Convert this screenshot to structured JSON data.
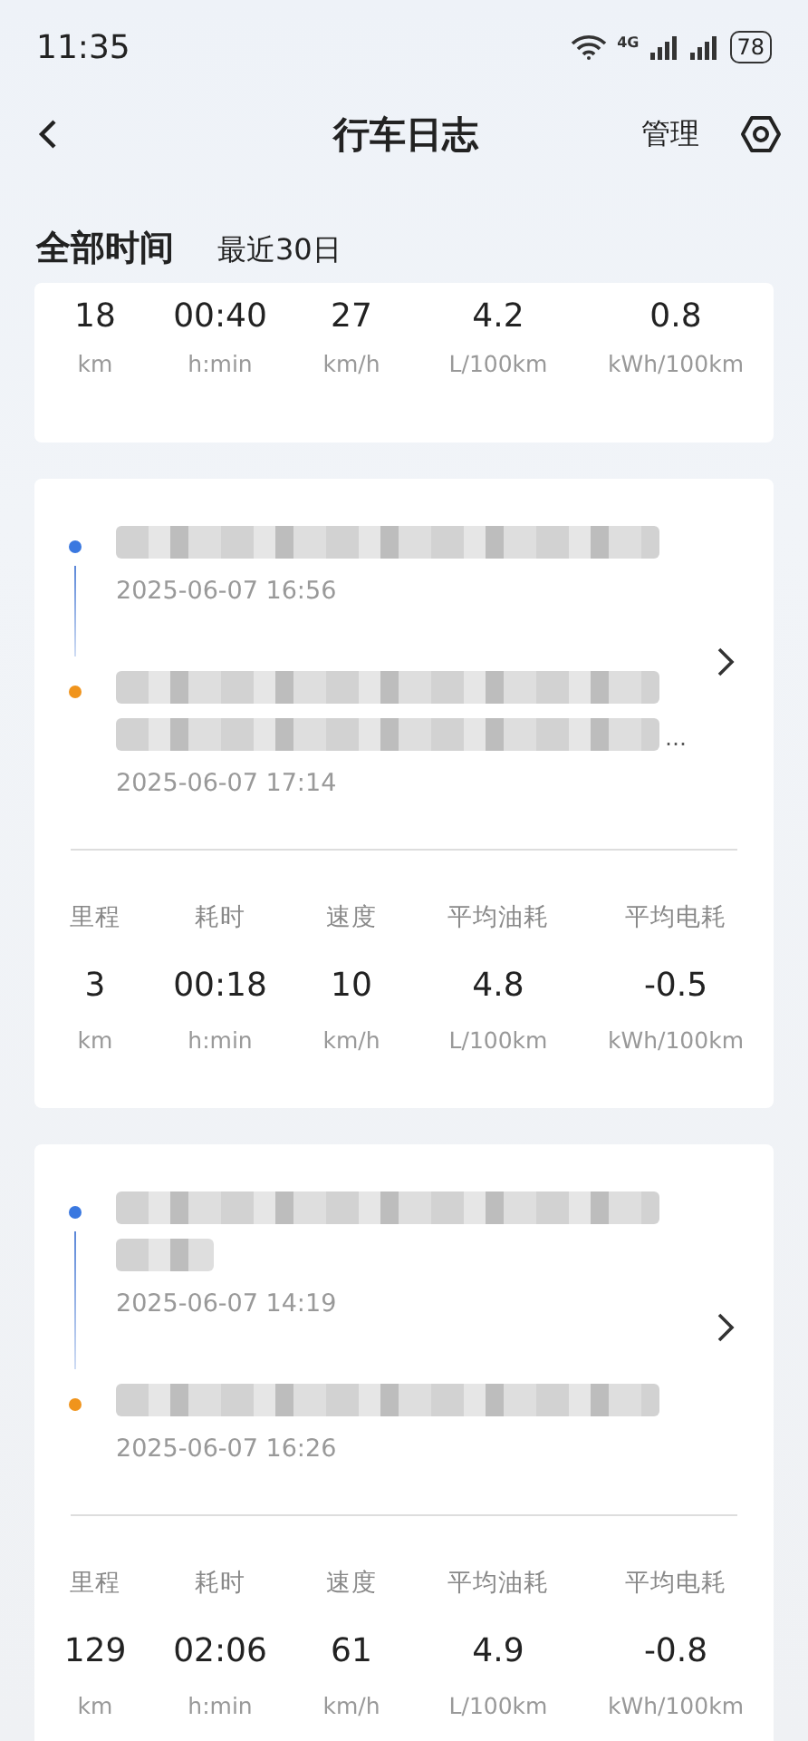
{
  "status_bar": {
    "time": "11:35",
    "network": "4G",
    "battery": "78"
  },
  "header": {
    "title": "行车日志",
    "action": "管理"
  },
  "tabs": [
    {
      "label": "全部时间",
      "selected": true
    },
    {
      "label": "最近30日",
      "selected": false
    }
  ],
  "summary": {
    "values": [
      "18",
      "00:40",
      "27",
      "4.2",
      "0.8"
    ],
    "units": [
      "km",
      "h:min",
      "km/h",
      "L/100km",
      "kWh/100km"
    ]
  },
  "trips": [
    {
      "start": {
        "address_rows": [
          {
            "kind": "full"
          }
        ],
        "time": "2025-06-07 16:56"
      },
      "end": {
        "address_rows": [
          {
            "kind": "full"
          },
          {
            "kind": "full",
            "suffix": "…"
          }
        ],
        "time": "2025-06-07 17:14"
      },
      "labels": [
        "里程",
        "耗时",
        "速度",
        "平均油耗",
        "平均电耗"
      ],
      "values": [
        "3",
        "00:18",
        "10",
        "4.8",
        "-0.5"
      ],
      "units": [
        "km",
        "h:min",
        "km/h",
        "L/100km",
        "kWh/100km"
      ]
    },
    {
      "start": {
        "address_rows": [
          {
            "kind": "full"
          },
          {
            "kind": "short"
          }
        ],
        "time": "2025-06-07 14:19"
      },
      "end": {
        "address_rows": [
          {
            "kind": "full"
          }
        ],
        "time": "2025-06-07 16:26"
      },
      "labels": [
        "里程",
        "耗时",
        "速度",
        "平均油耗",
        "平均电耗"
      ],
      "values": [
        "129",
        "02:06",
        "61",
        "4.9",
        "-0.8"
      ],
      "units": [
        "km",
        "h:min",
        "km/h",
        "L/100km",
        "kWh/100km"
      ]
    }
  ]
}
